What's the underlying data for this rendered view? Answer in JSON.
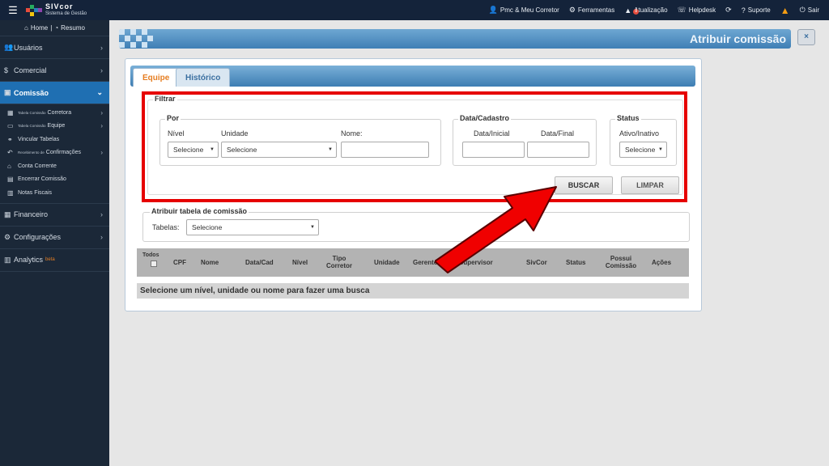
{
  "topbar": {
    "logo_title": "SIVcor",
    "logo_subtitle": "Sistema de Gestão",
    "items": [
      {
        "label": "Pmc & Meu Corretor",
        "icon": "user-icon"
      },
      {
        "label": "Ferramentas",
        "icon": "tools-icon"
      },
      {
        "label": "Atualização",
        "icon": "alert-icon",
        "badge": "8"
      },
      {
        "label": "Helpdesk",
        "icon": "helpdesk-icon"
      },
      {
        "label": "",
        "icon": "refresh-icon"
      },
      {
        "label": "Suporte",
        "icon": "question-icon"
      },
      {
        "label": "",
        "icon": "warning-icon"
      },
      {
        "label": "Sair",
        "icon": "power-icon"
      }
    ]
  },
  "sidebar": {
    "home": "Home",
    "resumo": "Resumo",
    "items": [
      {
        "label": "Usuários",
        "icon": "users-icon"
      },
      {
        "label": "Comercial",
        "icon": "dollar-icon"
      },
      {
        "label": "Comissão",
        "icon": "commission-icon",
        "active": true
      },
      {
        "label": "Financeiro",
        "icon": "finance-icon"
      },
      {
        "label": "Configurações",
        "icon": "cogs-icon"
      },
      {
        "label": "Analytics",
        "icon": "chart-icon",
        "tag": "beta"
      }
    ],
    "sub_items": [
      {
        "small": "Tabela Comissão",
        "label": "Corretora",
        "chevron": true
      },
      {
        "small": "Tabela Comissão",
        "label": "Equipe",
        "chevron": true
      },
      {
        "small": "",
        "label": "Vincular Tabelas",
        "chevron": false
      },
      {
        "small": "Recebimento de",
        "label": "Confirmações",
        "chevron": true
      },
      {
        "small": "",
        "label": "Conta Corrente",
        "chevron": false
      },
      {
        "small": "",
        "label": "Encerrar Comissão",
        "chevron": false
      },
      {
        "small": "",
        "label": "Notas Fiscais",
        "chevron": false
      }
    ]
  },
  "page": {
    "title": "Atribuir comissão",
    "close": "×",
    "tabs": [
      "Equipe",
      "Histórico"
    ],
    "filter": {
      "legend": "Filtrar",
      "por": {
        "legend": "Por",
        "nivel_label": "Nível",
        "nivel_value": "Selecione",
        "unidade_label": "Unidade",
        "unidade_value": "Selecione",
        "nome_label": "Nome:",
        "nome_value": ""
      },
      "data": {
        "legend": "Data/Cadastro",
        "inicial_label": "Data/Inicial",
        "final_label": "Data/Final"
      },
      "status": {
        "legend": "Status",
        "label": "Ativo/Inativo",
        "value": "Selecione"
      },
      "buscar": "BUSCAR",
      "limpar": "LIMPAR"
    },
    "assign": {
      "legend": "Atribuir tabela de comissão",
      "tabelas_label": "Tabelas:",
      "tabelas_value": "Selecione"
    },
    "table": {
      "headers": [
        "Todos",
        "CPF",
        "Nome",
        "Data/Cad",
        "Nível",
        "Tipo Corretor",
        "Unidade",
        "Gerente",
        "Supervisor",
        "SivCor",
        "Status",
        "Possui Comissão",
        "Ações"
      ],
      "empty_message": "Selecione um nível, unidade ou nome para fazer uma busca"
    }
  }
}
